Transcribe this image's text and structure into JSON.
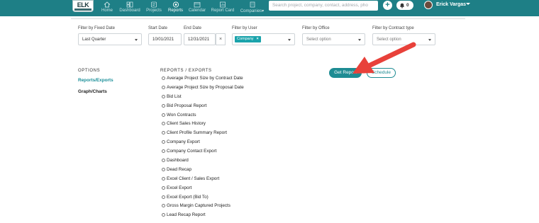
{
  "app": {
    "logo_text": "ELK",
    "accent": "#1e7f86",
    "highlight": "#1aa3ab"
  },
  "nav": {
    "items": [
      {
        "label": "Home",
        "icon": "home-icon"
      },
      {
        "label": "Dashboard",
        "icon": "dashboard-icon"
      },
      {
        "label": "Projects",
        "icon": "projects-icon"
      },
      {
        "label": "Reports",
        "icon": "reports-icon",
        "active": true
      },
      {
        "label": "Calendar",
        "icon": "calendar-icon"
      },
      {
        "label": "Report Card",
        "icon": "report-card-icon"
      },
      {
        "label": "Companies",
        "icon": "companies-icon"
      }
    ],
    "search_placeholder": "Search project, company, contact, address, pho",
    "notification_count": "0",
    "user_name": "Erick Vargas"
  },
  "filters": {
    "fixed_date": {
      "label": "Filter by Fixed Date",
      "value": "Last Quarter"
    },
    "start_date": {
      "label": "Start Date",
      "value": "10/01/2021"
    },
    "end_date": {
      "label": "End Date",
      "value": "12/31/2021",
      "clear": "×"
    },
    "user": {
      "label": "Filter by User",
      "chip": "Company",
      "chip_remove": "×"
    },
    "office": {
      "label": "Filter by Office",
      "placeholder": "Select option"
    },
    "contract_type": {
      "label": "Filter by Contract type",
      "placeholder": "Select option"
    }
  },
  "options": {
    "heading": "OPTIONS",
    "items": [
      {
        "label": "Reports/Exports",
        "active": true
      },
      {
        "label": "Graph/Charts",
        "active": false
      }
    ]
  },
  "reports": {
    "heading": "REPORTS / EXPORTS",
    "items": [
      "Average Project Size by Contract Date",
      "Average Project Size by Proposal Date",
      "Bid List",
      "Bid Proposal Report",
      "Won Contracts",
      "Client Sales History",
      "Client Profile Summary Report",
      "Company Export",
      "Company Contact Export",
      "Dashboard",
      "Dead Recap",
      "Excel Client / Sales Export",
      "Excel Export",
      "Excel Export (Bid To)",
      "Gross Margin Captured Projects",
      "Lead Recap Report"
    ]
  },
  "actions": {
    "get_report": "Get Report",
    "schedule": "Schedule"
  },
  "annotation": {
    "arrow_color": "#e8413a"
  }
}
